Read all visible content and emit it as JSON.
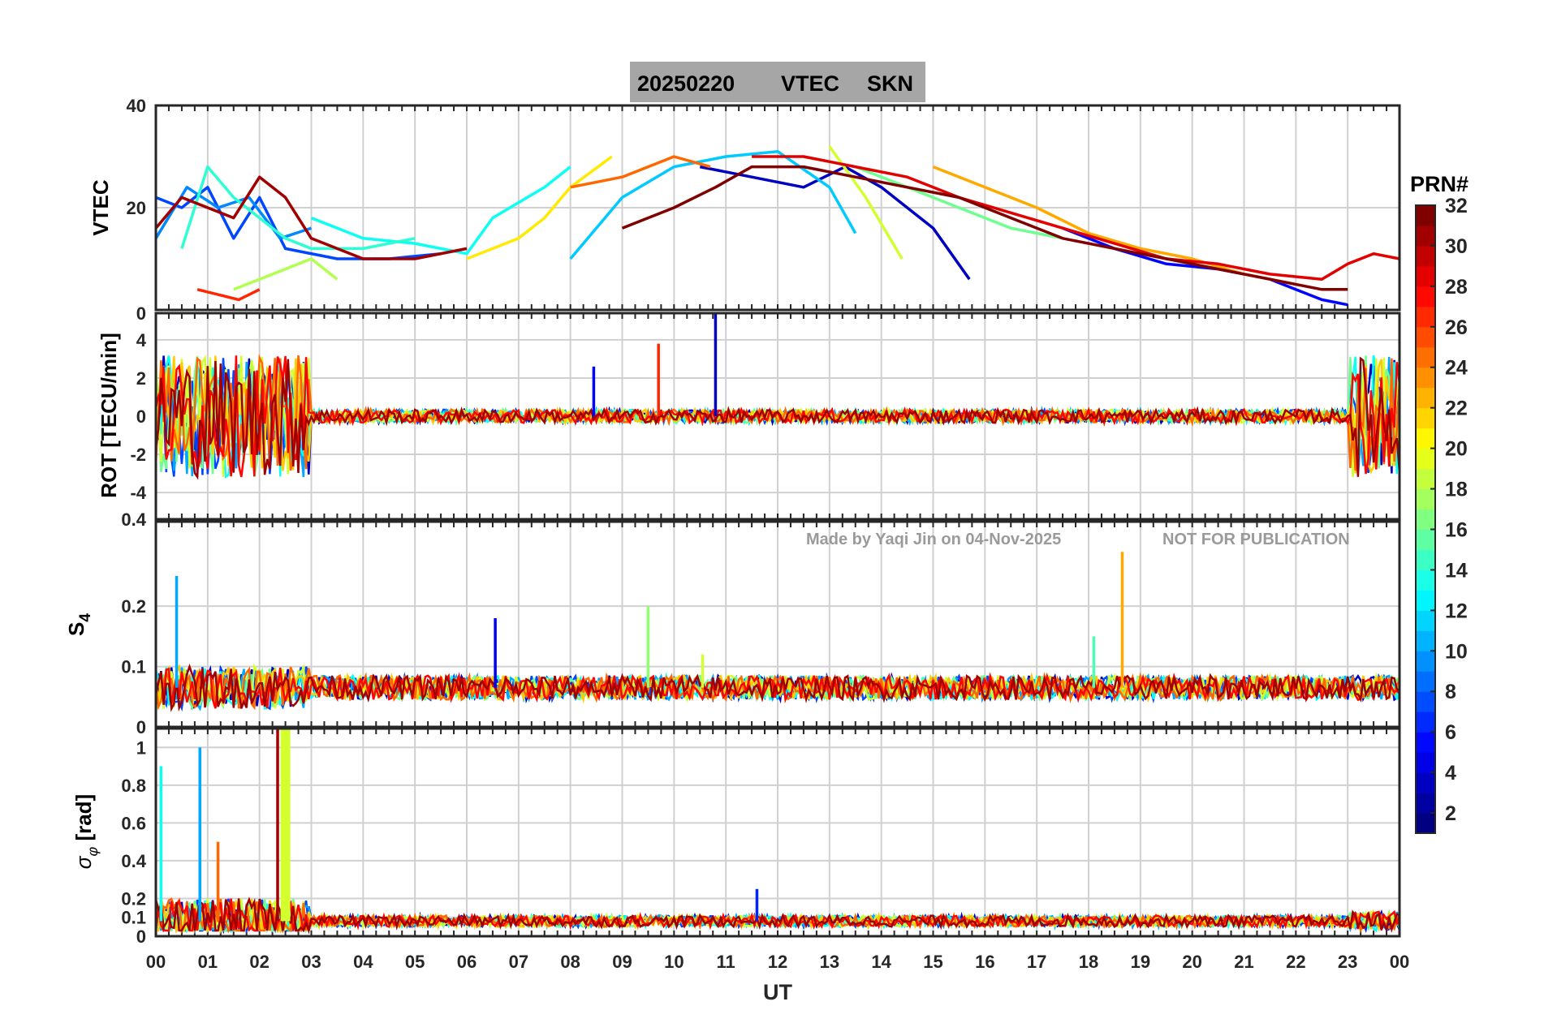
{
  "title": {
    "date": "20250220",
    "product": "VTEC",
    "station": "SKN"
  },
  "watermark": {
    "made_by": "Made by Yaqi Jin on 04-Nov-2025",
    "notice": "NOT FOR PUBLICATION"
  },
  "x_axis": {
    "label": "UT",
    "ticks": [
      "00",
      "01",
      "02",
      "03",
      "04",
      "05",
      "06",
      "07",
      "08",
      "09",
      "10",
      "11",
      "12",
      "13",
      "14",
      "15",
      "16",
      "17",
      "18",
      "19",
      "20",
      "21",
      "22",
      "23",
      "00"
    ]
  },
  "colorbar": {
    "title": "PRN#",
    "ticks": [
      "2",
      "4",
      "6",
      "8",
      "10",
      "12",
      "14",
      "16",
      "18",
      "20",
      "22",
      "24",
      "26",
      "28",
      "30",
      "32"
    ],
    "colormap": "jet",
    "range": [
      1,
      32
    ]
  },
  "colors": {
    "title_bg": "#a6a6a6",
    "grid": "#d0d0d0",
    "watermark": "#9a9a9a"
  },
  "chart_data": [
    {
      "type": "line",
      "panel": "VTEC",
      "ylabel": "VTEC",
      "ylim": [
        0,
        40
      ],
      "yticks": [
        "40",
        "20"
      ],
      "grid": true,
      "series": [
        {
          "prn": 3,
          "x": [
            10.5,
            11.5,
            12.5,
            13.3,
            14.0,
            15.0,
            15.7
          ],
          "values": [
            28,
            26,
            24,
            28,
            24,
            16,
            6
          ]
        },
        {
          "prn": 5,
          "x": [
            17.5,
            18.5,
            19.5,
            20.5,
            21.5,
            22.5,
            23.0
          ],
          "values": [
            16,
            12,
            9,
            8,
            6,
            2,
            1
          ]
        },
        {
          "prn": 7,
          "x": [
            0.0,
            0.5,
            1.0,
            1.5,
            2.0,
            2.5,
            3.5,
            4.5,
            5.5
          ],
          "values": [
            22,
            20,
            24,
            14,
            22,
            12,
            10,
            10,
            11
          ]
        },
        {
          "prn": 9,
          "x": [
            0.0,
            0.6,
            1.2,
            1.8,
            2.4,
            3.0
          ],
          "values": [
            14,
            24,
            20,
            22,
            14,
            16
          ]
        },
        {
          "prn": 11,
          "x": [
            8.0,
            9.0,
            10.0,
            11.0,
            12.0,
            13.0,
            13.5
          ],
          "values": [
            10,
            22,
            28,
            30,
            31,
            24,
            15
          ]
        },
        {
          "prn": 13,
          "x": [
            3.0,
            4.0,
            5.0,
            6.0,
            6.5,
            7.0,
            7.5,
            8.0
          ],
          "values": [
            18,
            14,
            13,
            11,
            18,
            21,
            24,
            28
          ]
        },
        {
          "prn": 14,
          "x": [
            0.5,
            1.0,
            1.5,
            2.0,
            2.5,
            3.0,
            4.0,
            5.0
          ],
          "values": [
            12,
            28,
            22,
            18,
            14,
            12,
            12,
            14
          ]
        },
        {
          "prn": 16,
          "x": [
            12.5,
            13.5,
            14.5,
            15.5,
            16.5,
            17.5
          ],
          "values": [
            30,
            28,
            24,
            20,
            16,
            14
          ]
        },
        {
          "prn": 18,
          "x": [
            1.5,
            2.0,
            2.5,
            3.0,
            3.5
          ],
          "values": [
            4,
            6,
            8,
            10,
            6
          ]
        },
        {
          "prn": 19,
          "x": [
            13.0,
            13.7,
            14.4
          ],
          "values": [
            32,
            22,
            10
          ]
        },
        {
          "prn": 21,
          "x": [
            6.0,
            7.0,
            7.5,
            8.0,
            8.8
          ],
          "values": [
            10,
            14,
            18,
            24,
            30
          ]
        },
        {
          "prn": 23,
          "x": [
            15.0,
            16.0,
            17.0,
            18.0,
            19.0,
            20.0,
            21.0,
            22.0
          ],
          "values": [
            28,
            24,
            20,
            15,
            12,
            10,
            7,
            5
          ]
        },
        {
          "prn": 25,
          "x": [
            8.0,
            9.0,
            10.0,
            10.7
          ],
          "values": [
            24,
            26,
            30,
            28
          ]
        },
        {
          "prn": 27,
          "x": [
            0.8,
            1.2,
            1.6,
            2.0
          ],
          "values": [
            4,
            3,
            2,
            4
          ]
        },
        {
          "prn": 29,
          "x": [
            11.5,
            12.5,
            13.5,
            14.5,
            15.5,
            16.5,
            17.5,
            18.5,
            19.5,
            20.5,
            21.5,
            22.5,
            23.0,
            23.5,
            24.0
          ],
          "values": [
            30,
            30,
            28,
            26,
            22,
            19,
            16,
            13,
            10,
            9,
            7,
            6,
            9,
            11,
            10
          ]
        },
        {
          "prn": 31,
          "x": [
            0.0,
            0.5,
            1.0,
            1.5,
            2.0,
            2.5,
            3.0,
            3.5,
            4.0,
            5.0,
            6.0
          ],
          "values": [
            16,
            22,
            20,
            18,
            26,
            22,
            14,
            12,
            10,
            10,
            12
          ]
        },
        {
          "prn": 32,
          "x": [
            9.0,
            10.0,
            10.8,
            11.5,
            12.5,
            13.5,
            14.5,
            15.5,
            16.5,
            17.5,
            18.5,
            19.5,
            20.5,
            21.5,
            22.5,
            23.0
          ],
          "values": [
            16,
            20,
            24,
            28,
            28,
            26,
            24,
            22,
            18,
            14,
            12,
            10,
            8,
            6,
            4,
            4
          ]
        }
      ]
    },
    {
      "type": "line",
      "panel": "ROT",
      "ylabel": "ROT [TECU/min]",
      "ylim": [
        -5.4,
        5.4
      ],
      "yticks": [
        "0",
        "4",
        "2",
        "0",
        "-2",
        "-4",
        "0.4"
      ],
      "grid": true,
      "summary": "Rate of TEC fluctuates around 0 TECU/min for all PRNs; large swings of about ±4 TECU/min near 00-03 UT and near 23-00 UT; isolated spikes near 08.5 UT (PRN 5, ~2.6), 09.7 UT (PRN 27, ~3.8) and 10.8 UT (PRN 3, ~5.5).",
      "spikes": [
        {
          "prn": 5,
          "x": 8.45,
          "value": 2.6
        },
        {
          "prn": 27,
          "x": 9.7,
          "value": 3.8
        },
        {
          "prn": 3,
          "x": 10.8,
          "value": 5.5
        }
      ]
    },
    {
      "type": "line",
      "panel": "S4",
      "ylabel": "S4",
      "ylim": [
        0,
        0.34
      ],
      "yticks": [
        "0.2",
        "0.1",
        "0"
      ],
      "grid": true,
      "summary": "Amplitude scintillation index mostly between 0.04 and 0.10; enhanced up to ~0.25 before 03 UT; isolated spikes near 06.5 UT (~0.18), 09.5 UT (~0.20), 10.5 UT (~0.12) and 18.6 UT (~0.29).",
      "spikes": [
        {
          "prn": 10,
          "x": 0.4,
          "value": 0.25
        },
        {
          "prn": 4,
          "x": 6.55,
          "value": 0.18
        },
        {
          "prn": 17,
          "x": 9.5,
          "value": 0.2
        },
        {
          "prn": 19,
          "x": 10.55,
          "value": 0.12
        },
        {
          "prn": 15,
          "x": 18.1,
          "value": 0.15
        },
        {
          "prn": 23,
          "x": 18.65,
          "value": 0.29
        }
      ]
    },
    {
      "type": "line",
      "panel": "sigma_phi",
      "ylabel": "σφ [rad]",
      "ylim": [
        0,
        1.1
      ],
      "yticks": [
        "1",
        "0.8",
        "0.6",
        "0.4",
        "0.2",
        "0.1",
        "0"
      ],
      "grid": true,
      "summary": "Phase scintillation index mostly below 0.15 rad; strong enhancements before 03 UT reaching ~1.0 rad (PRN 10 near 00.8 UT, PRN 29 and PRN 19 near 02.3-02.6 UT); moderate rise after 23 UT.",
      "spikes": [
        {
          "prn": 13,
          "x": 0.1,
          "value": 0.9
        },
        {
          "prn": 10,
          "x": 0.85,
          "value": 1.0
        },
        {
          "prn": 25,
          "x": 1.2,
          "value": 0.5
        },
        {
          "prn": 31,
          "x": 2.35,
          "value": 1.1
        },
        {
          "prn": 19,
          "x": 2.5,
          "value": 1.1
        },
        {
          "prn": 6,
          "x": 11.6,
          "value": 0.25
        }
      ]
    }
  ]
}
